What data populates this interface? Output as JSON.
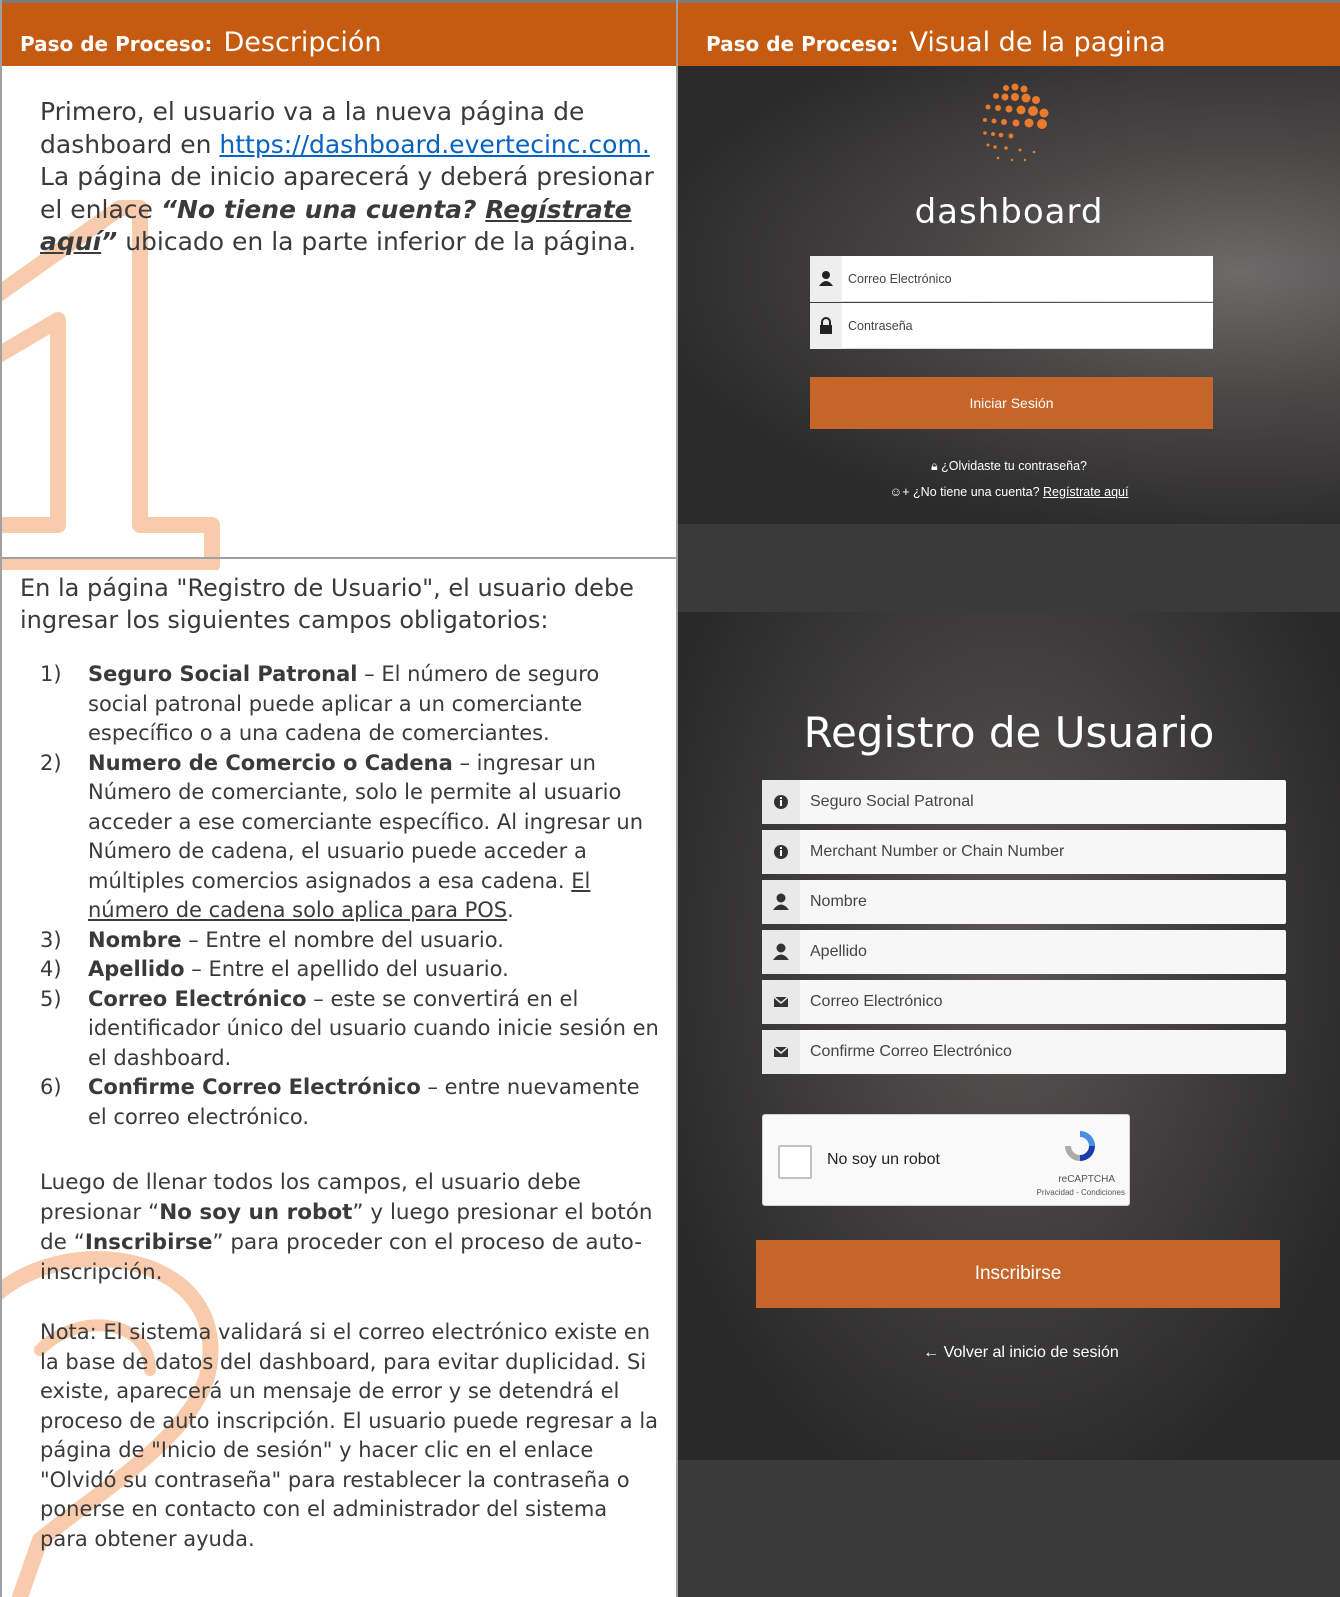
{
  "header": {
    "left_label": "Paso de Proceso:",
    "left_value": "Descripción",
    "right_label": "Paso de Proceso:",
    "right_value": "Visual de la pagina"
  },
  "step1": {
    "text_intro": "Primero, el usuario va a la nueva página de dashboard en ",
    "link": "https://dashboard.evertecinc.com.",
    "text_mid": " La página de inicio aparecerá y deberá presionar el enlace ",
    "quote_open": "“No tiene una cuenta? ",
    "quote_link": "Regístrate aquí",
    "quote_close": "”",
    "text_end": " ubicado en la parte inferior de la página."
  },
  "step2": {
    "intro": "En la página \"Registro de Usuario\", el usuario debe ingresar los siguientes campos obligatorios:",
    "items": [
      {
        "num": "1)",
        "bold": "Seguro Social Patronal",
        "rest": " – El número de seguro social patronal puede aplicar a un comerciante específico o a una cadena de comerciantes."
      },
      {
        "num": "2)",
        "bold": "Numero de Comercio o Cadena",
        "rest": " – ingresar un Número de comerciante, solo le permite al usuario acceder a ese comerciante específico. Al ingresar un Número de cadena, el usuario puede acceder a múltiples comercios asignados a esa cadena. ",
        "underline": "El número de cadena solo aplica para POS",
        "tail": "."
      },
      {
        "num": "3)",
        "bold": "Nombre",
        "rest": " – Entre el nombre del usuario."
      },
      {
        "num": "4)",
        "bold": "Apellido",
        "rest": " – Entre el apellido del usuario."
      },
      {
        "num": "5)",
        "bold": "Correo Electrónico",
        "rest": " – este se convertirá en el identificador único del usuario cuando inicie sesión en el dashboard."
      },
      {
        "num": "6)",
        "bold": "Confirme Correo Electrónico",
        "rest": " – entre nuevamente el correo electrónico."
      }
    ],
    "after_a": "Luego de llenar todos los campos, el usuario debe presionar “",
    "after_b1": "No soy un robot",
    "after_c": "” y luego presionar el botón de “",
    "after_b2": "Inscribirse",
    "after_d": "” para proceder con el proceso de auto-inscripción.",
    "note": "Nota:  El sistema validará si el correo electrónico existe en la base de datos del dashboard, para evitar duplicidad. Si existe, aparecerá un mensaje de error y se detendrá el proceso de auto inscripción. El usuario puede regresar a la página de \"Inicio de sesión\" y hacer clic en el enlace \"Olvidó su contraseña\" para restablecer la contraseña o ponerse en contacto con el administrador del sistema para obtener ayuda."
  },
  "login_screen": {
    "brand": "dashboard",
    "email_placeholder": "Correo Electrónico",
    "password_placeholder": "Contraseña",
    "login_button": "Iniciar Sesión",
    "forgot_link": "¿Olvidaste tu contraseña?",
    "no_account_text": "¿No tiene una cuenta?",
    "register_link": "Regístrate aquí"
  },
  "register_screen": {
    "title": "Registro de Usuario",
    "fields": [
      {
        "placeholder": "Seguro Social Patronal",
        "icon": "info-icon"
      },
      {
        "placeholder": "Merchant Number or Chain Number",
        "icon": "info-icon"
      },
      {
        "placeholder": "Nombre",
        "icon": "user-icon"
      },
      {
        "placeholder": "Apellido",
        "icon": "user-icon"
      },
      {
        "placeholder": "Correo Electrónico",
        "icon": "envelope-icon"
      },
      {
        "placeholder": "Confirme Correo Electrónico",
        "icon": "envelope-icon"
      }
    ],
    "captcha_label": "No soy un robot",
    "captcha_brand": "reCAPTCHA",
    "captcha_terms": "Privacidad - Condiciones",
    "submit_button": "Inscribirse",
    "back_link": "Volver al inicio de sesión"
  },
  "colors": {
    "header_bg": "#c55a11",
    "button_bg": "#c6652a",
    "link": "#0563c1",
    "deco_digit": "#f8cbad"
  }
}
